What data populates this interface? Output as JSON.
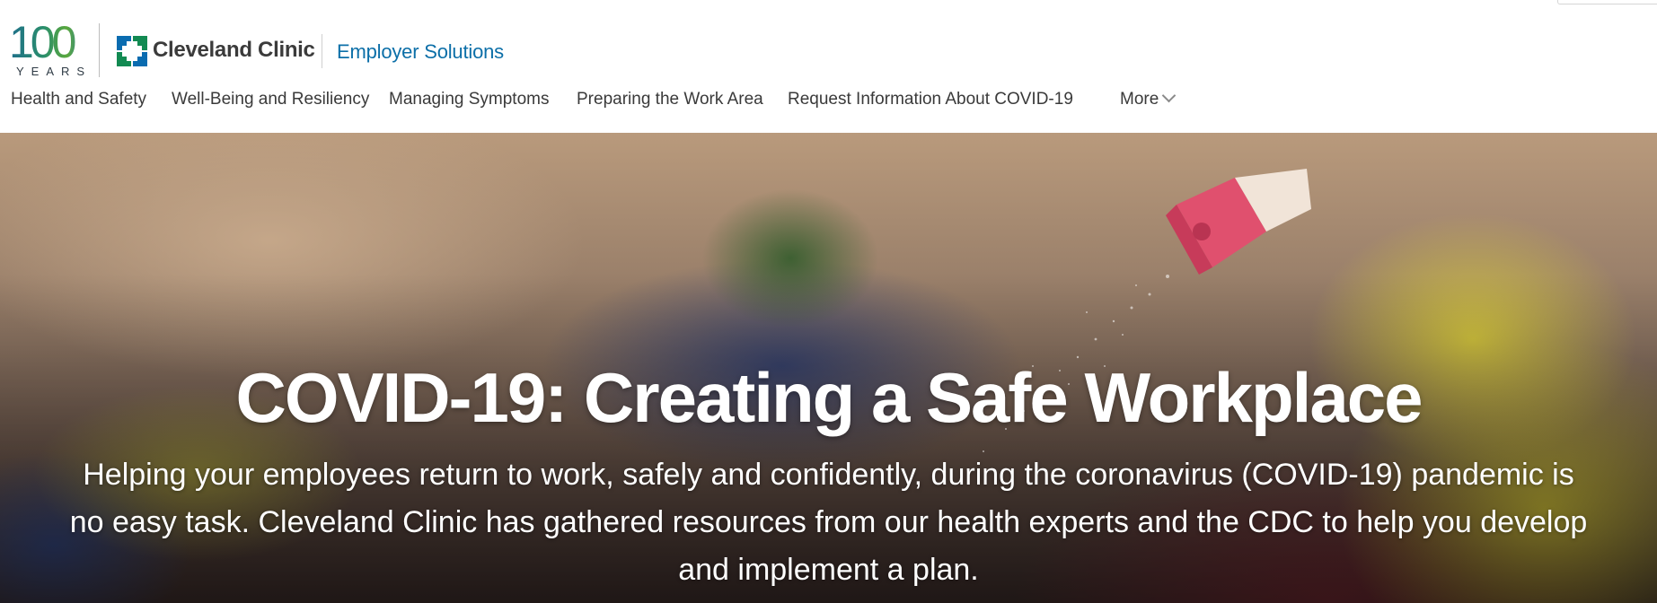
{
  "brand": {
    "anniversary_number": "100",
    "anniversary_word": "YEARS",
    "clinic_name": "Cleveland Clinic",
    "section": "Employer Solutions",
    "colors": {
      "section_blue": "#0c6fa8",
      "clinic_green": "#128a52",
      "clinic_blue": "#0a6cb0"
    }
  },
  "nav": {
    "items": [
      {
        "label": "Health and Safety"
      },
      {
        "label": "Well-Being and Resiliency"
      },
      {
        "label": "Managing Symptoms"
      },
      {
        "label": "Preparing the Work Area"
      },
      {
        "label": "Request Information About COVID-19"
      }
    ],
    "more_label": "More",
    "more_icon": "chevron-down-icon"
  },
  "hero": {
    "title": "COVID-19: Creating a Safe Workplace",
    "text": "Helping your employees return to work, safely and confidently, during the coronavirus (COVID-19) pandemic is no easy task. Cleveland Clinic has gathered resources from our health experts and the CDC to help you develop and implement a plan."
  }
}
